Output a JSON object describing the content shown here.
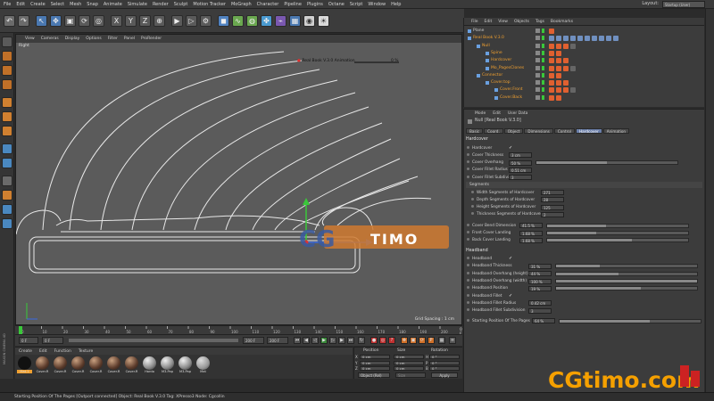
{
  "menubar": [
    "File",
    "Edit",
    "Create",
    "Select",
    "Mesh",
    "Snap",
    "Animate",
    "Simulate",
    "Render",
    "Sculpt",
    "Motion Tracker",
    "MoGraph",
    "Character",
    "Pipeline",
    "Plugins",
    "Octane",
    "Script",
    "Window",
    "Help"
  ],
  "layout": {
    "label": "Layout:",
    "value": "Startup (User)"
  },
  "viewport": {
    "menu": [
      "View",
      "Cameras",
      "Display",
      "Options",
      "Filter",
      "Panel",
      "ProRender"
    ],
    "label": "Right",
    "grid_spacing": "Grid Spacing : 1 cm",
    "anim_overlay_label": "Real Book V.3.0 Animation",
    "anim_overlay_value": "0 %"
  },
  "timeline": {
    "start": "0 F",
    "current": "0 F",
    "end": "200 F",
    "end2": "200 F",
    "ticks": [
      "0",
      "10",
      "20",
      "30",
      "40",
      "50",
      "60",
      "70",
      "80",
      "90",
      "100",
      "110",
      "120",
      "130",
      "140",
      "150",
      "160",
      "170",
      "180",
      "190",
      "200"
    ],
    "frame_label": "0 F"
  },
  "materials": {
    "menu": [
      "Create",
      "Edit",
      "Function",
      "Texture"
    ],
    "items": [
      "Mat.1",
      "Cover.R",
      "Cover.R",
      "Cover.R",
      "Cover.R",
      "Cover.R",
      "Cover.R",
      "Hardo",
      "M3.Pap",
      "M3.Pap",
      "Mat"
    ]
  },
  "coords": {
    "headers": [
      "Position",
      "Size",
      "Rotation"
    ],
    "rows": [
      {
        "axis": "X",
        "pos": "0 cm",
        "size": "0 cm",
        "rotl": "H",
        "rot": "0 °"
      },
      {
        "axis": "Y",
        "pos": "0 cm",
        "size": "0 cm",
        "rotl": "P",
        "rot": "0 °"
      },
      {
        "axis": "Z",
        "pos": "0 cm",
        "size": "0 cm",
        "rotl": "B",
        "rot": "0 °"
      }
    ],
    "object_mode": "Object (Rel)",
    "size_mode": "Size",
    "apply": "Apply"
  },
  "status": "Starting Position Of The Pages [Outport connected] Object: Real Book V.3.0 Tag: XPresso3 Node: Cgcollin",
  "objmgr": {
    "menu": [
      "File",
      "Edit",
      "View",
      "Objects",
      "Tags",
      "Bookmarks"
    ],
    "rows": [
      {
        "name": "Plane",
        "indent": 10,
        "color": "#cfcfcf"
      },
      {
        "name": "Real Book V.3.0",
        "indent": 10,
        "color": "#f0a030"
      },
      {
        "name": "Null",
        "indent": 20,
        "color": "#f0a030"
      },
      {
        "name": "Spine",
        "indent": 30,
        "color": "#f0a030"
      },
      {
        "name": "Hardcover",
        "indent": 30,
        "color": "#f0a030"
      },
      {
        "name": "Mo_PagesClones",
        "indent": 30,
        "color": "#f0a030"
      },
      {
        "name": "Connector",
        "indent": 20,
        "color": "#f0a030"
      },
      {
        "name": "Cover.top",
        "indent": 30,
        "color": "#f0a030"
      },
      {
        "name": "Cover.Front",
        "indent": 40,
        "color": "#f0a030"
      },
      {
        "name": "Cover.Back",
        "indent": 40,
        "color": "#f0a030"
      }
    ]
  },
  "attr": {
    "menu": [
      "Mode",
      "Edit",
      "User Data"
    ],
    "title": "Null [Real Book V.3.0]",
    "tabs": [
      "Basic",
      "Coord.",
      "Object",
      "Dimensions",
      "Control",
      "Hardcover",
      "Animation"
    ],
    "active_tab": "Hardcover",
    "section_hardcover": "Hardcover",
    "section_headband": "Headband",
    "hardcover": [
      {
        "label": "Hardcover",
        "type": "check"
      },
      {
        "label": "Cover Thickness",
        "value": "3 cm",
        "fill": 0
      },
      {
        "label": "Cover Overhang",
        "value": "50 %",
        "fill": 0.5
      },
      {
        "label": "Cover Fillet Radius",
        "value": "0.51 cm",
        "fill": 0
      },
      {
        "label": "Cover Fillet Subdivision",
        "value": "3",
        "fill": 0
      }
    ],
    "segments_label": "Segments",
    "segments": [
      {
        "label": "Width Segments of Hardcover",
        "value": "271"
      },
      {
        "label": "Depth Segments of Hardcover",
        "value": "28"
      },
      {
        "label": "Height Segments of Hardcover",
        "value": "125"
      },
      {
        "label": "Thickness Segments of Hardcover",
        "value": "2"
      }
    ],
    "cover_bend": [
      {
        "label": "Cover Bend Dimension",
        "value": "41.5 %",
        "fill": 0.415
      },
      {
        "label": "Front Cover Landing",
        "value": "1.68 %",
        "fill": 0.35
      },
      {
        "label": "Back Cover Landing",
        "value": "1.68 %",
        "fill": 0.6
      }
    ],
    "headband": [
      {
        "label": "Headband",
        "type": "check"
      },
      {
        "label": "Headband Thickness",
        "value": "31 %",
        "fill": 0.31
      },
      {
        "label": "Headband Overhang (height)",
        "value": "44 %",
        "fill": 0.44
      },
      {
        "label": "Headband Overhang (width)",
        "value": "100 %",
        "fill": 1.0
      },
      {
        "label": "Headband Position",
        "value": "19 %",
        "fill": 0.6
      },
      {
        "label": "Headband Fillet",
        "type": "check"
      },
      {
        "label": "Headband Fillet Radius",
        "value": "0.42 cm",
        "fill": 0
      },
      {
        "label": "Headband Fillet Subdivision",
        "value": "3",
        "fill": 0
      }
    ],
    "start_pages": {
      "label": "Starting Position Of The Pages",
      "value": "64 %",
      "fill": 0.64
    }
  },
  "watermark": "CGtimo.com",
  "center_watermark": "CGTIMO",
  "brand_strip": "MAXON CINEMA 4D"
}
